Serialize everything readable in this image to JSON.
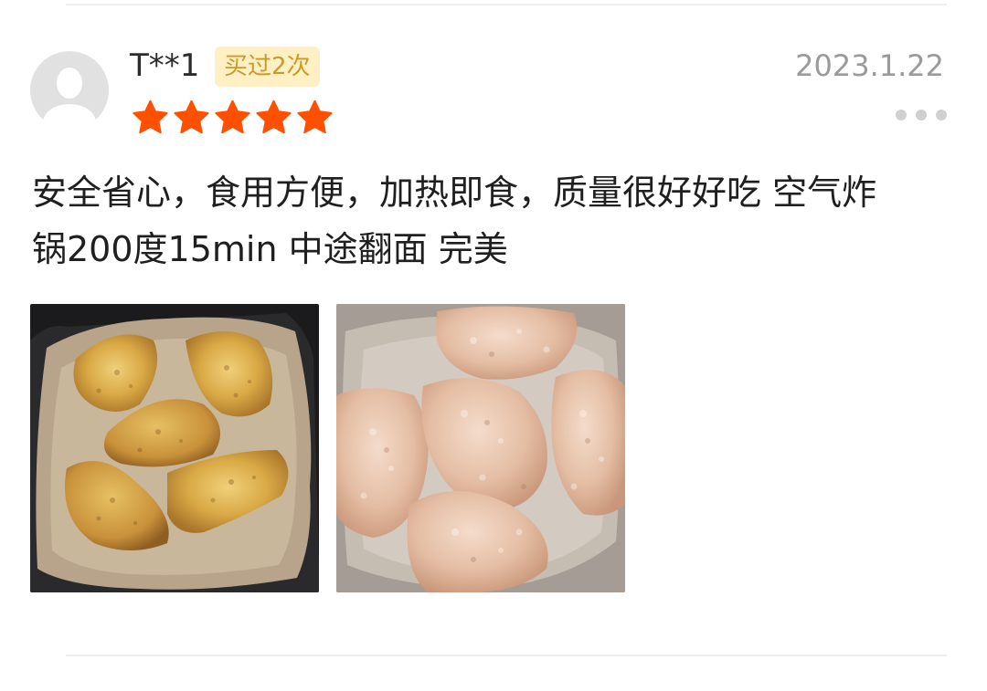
{
  "review": {
    "user": {
      "name": "T**1",
      "badge": "买过2次"
    },
    "date": "2023.1.22",
    "rating": 5,
    "rating_max": 5,
    "text_lines": [
      "安全省心，食用方便，加热即食，质量很好好吃 空气炸",
      "锅200度15min 中途翻面 完美"
    ],
    "more_icon": "more-dots-icon",
    "star_icon": "star-icon",
    "colors": {
      "star": "#ff5000",
      "badge_bg": "#fff0c4",
      "badge_text": "#c99a2c",
      "date": "#9a9a9a"
    },
    "photos": [
      {
        "name": "photo-cooked-chicken"
      },
      {
        "name": "photo-raw-chicken"
      }
    ]
  }
}
